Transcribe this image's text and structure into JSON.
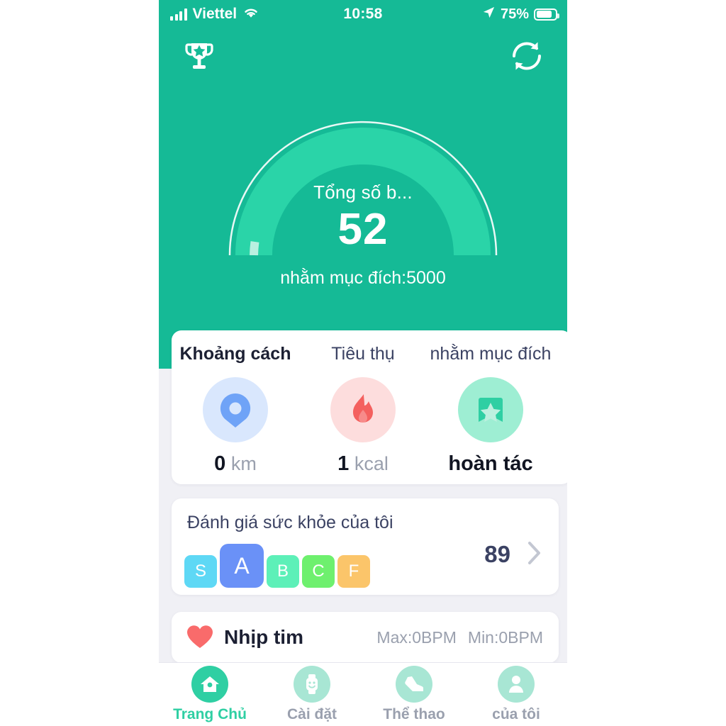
{
  "statusbar": {
    "carrier": "Viettel",
    "time": "10:58",
    "battery_percent": "75%",
    "signal_icon": "signal-bars-icon",
    "wifi_icon": "wifi-icon",
    "location_icon": "location-arrow-icon",
    "battery_icon": "battery-icon"
  },
  "header": {
    "trophy_icon": "trophy-icon",
    "sync_icon": "sync-refresh-icon",
    "gauge": {
      "label": "Tổng số b...",
      "value": "52",
      "goal_text": "nhằm mục đích:5000",
      "goal_value": 5000,
      "current_value": 52,
      "track_color": "#2ad4a8",
      "ring_color": "#ffffff",
      "progress_color": "#b9f0e0"
    },
    "background_color": "#15ba96"
  },
  "stats": {
    "columns": [
      {
        "header": "Khoảng cách",
        "value": "0",
        "unit": "km",
        "icon": "location-pin-icon",
        "icon_bg": "#d9e7fd"
      },
      {
        "header": "Tiêu thụ",
        "value": "1",
        "unit": "kcal",
        "icon": "flame-icon",
        "icon_bg": "#fddddd"
      },
      {
        "header": "nhằm mục đích",
        "value": "hoàn tác",
        "unit": "",
        "icon": "badge-star-icon",
        "icon_bg": "#9eeed3"
      }
    ]
  },
  "health": {
    "title": "Đánh giá sức khỏe của tôi",
    "score": "89",
    "chevron_icon": "chevron-right-icon",
    "grades": [
      {
        "label": "S",
        "color": "#5ed8f5",
        "active": false
      },
      {
        "label": "A",
        "color": "#6a91f7",
        "active": true
      },
      {
        "label": "B",
        "color": "#5df0b8",
        "active": false
      },
      {
        "label": "C",
        "color": "#6ef06e",
        "active": false
      },
      {
        "label": "F",
        "color": "#fbc56a",
        "active": false
      }
    ]
  },
  "heartrate": {
    "icon": "heart-icon",
    "label": "Nhịp tim",
    "max": "Max:0BPM",
    "min": "Min:0BPM"
  },
  "bottomnav": {
    "items": [
      {
        "label": "Trang Chủ",
        "icon": "home-icon",
        "active": true
      },
      {
        "label": "Cài đặt",
        "icon": "smartwatch-icon",
        "active": false
      },
      {
        "label": "Thể thao",
        "icon": "shoe-icon",
        "active": false
      },
      {
        "label": "của tôi",
        "icon": "person-icon",
        "active": false
      }
    ]
  }
}
